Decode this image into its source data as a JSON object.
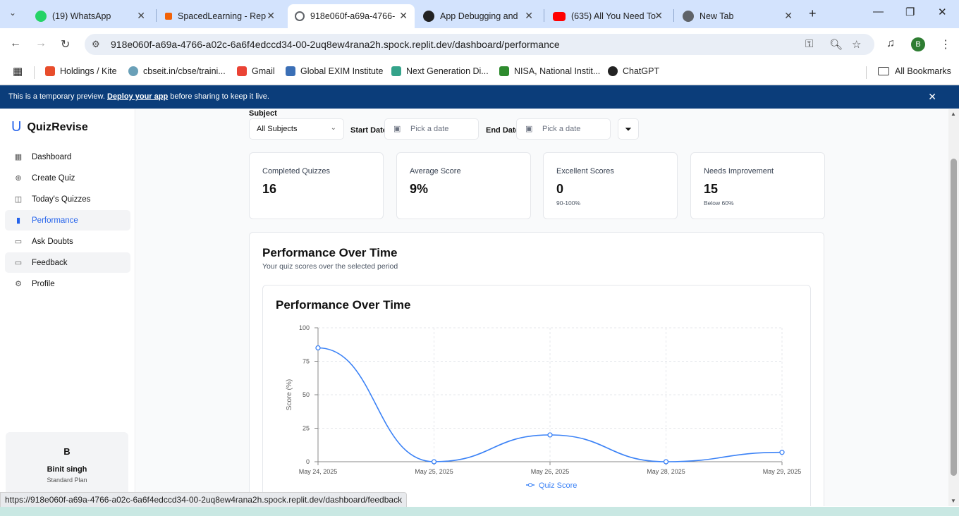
{
  "browser": {
    "tabs": [
      {
        "title": "(19) WhatsApp",
        "color": "#25d366"
      },
      {
        "title": "SpacedLearning - Rep",
        "color": "#f26207"
      },
      {
        "title": "918e060f-a69a-4766-",
        "color": "#5f6368"
      },
      {
        "title": "App Debugging and",
        "color": "#222222"
      },
      {
        "title": "(635) All You Need To",
        "color": "#ff0000"
      },
      {
        "title": "New Tab",
        "color": "#5f6368"
      }
    ],
    "url": "918e060f-a69a-4766-a02c-6a6f4edccd34-00-2uq8ew4rana2h.spock.replit.dev/dashboard/performance",
    "bookmarks": [
      {
        "label": "Holdings / Kite",
        "color": "#e84d2c"
      },
      {
        "label": "cbseit.in/cbse/traini...",
        "color": "#6aa0b8"
      },
      {
        "label": "Gmail",
        "color": "#ea4335"
      },
      {
        "label": "Global EXIM Institute",
        "color": "#3b6fb6"
      },
      {
        "label": "Next Generation Di...",
        "color": "#34a38a"
      },
      {
        "label": "NISA, National Instit...",
        "color": "#2e8b2e"
      },
      {
        "label": "ChatGPT",
        "color": "#222222"
      }
    ],
    "all_bookmarks": "All Bookmarks",
    "profile_initial": "B",
    "status_url": "https://918e060f-a69a-4766-a02c-6a6f4edccd34-00-2uq8ew4rana2h.spock.replit.dev/dashboard/feedback"
  },
  "banner": {
    "prefix": "This is a temporary preview. ",
    "link": "Deploy your app",
    "suffix": " before sharing to keep it live."
  },
  "sidebar": {
    "brand": "QuizRevise",
    "items": [
      {
        "label": "Dashboard",
        "icon": "grid-icon"
      },
      {
        "label": "Create Quiz",
        "icon": "plus-circle-icon"
      },
      {
        "label": "Today's Quizzes",
        "icon": "book-icon"
      },
      {
        "label": "Performance",
        "icon": "bar-chart-icon"
      },
      {
        "label": "Ask Doubts",
        "icon": "message-icon"
      },
      {
        "label": "Feedback",
        "icon": "message-square-icon"
      },
      {
        "label": "Profile",
        "icon": "gear-icon"
      }
    ],
    "user": {
      "initial": "B",
      "name": "Binit singh",
      "plan": "Standard Plan"
    }
  },
  "filters": {
    "subject_label": "Subject",
    "subject_value": "All Subjects",
    "start_label": "Start Date",
    "start_placeholder": "Pick a date",
    "end_label": "End Date",
    "end_placeholder": "Pick a date"
  },
  "stats": [
    {
      "label": "Completed Quizzes",
      "value": "16",
      "sub": ""
    },
    {
      "label": "Average Score",
      "value": "9%",
      "sub": ""
    },
    {
      "label": "Excellent Scores",
      "value": "0",
      "sub": "90-100%"
    },
    {
      "label": "Needs Improvement",
      "value": "15",
      "sub": "Below 60%"
    }
  ],
  "performance": {
    "title": "Performance Over Time",
    "subtitle": "Your quiz scores over the selected period"
  },
  "chart_data": {
    "type": "line",
    "title": "Performance Over Time",
    "ylabel": "Score (%)",
    "xlabel": "",
    "x": [
      "May 24, 2025",
      "May 25, 2025",
      "May 26, 2025",
      "May 28, 2025",
      "May 29, 2025"
    ],
    "series": [
      {
        "name": "Quiz Score",
        "values": [
          85,
          0,
          20,
          0,
          7
        ],
        "color": "#3b82f6"
      }
    ],
    "ylim": [
      0,
      100
    ],
    "yticks": [
      0,
      25,
      50,
      75,
      100
    ],
    "grid": true,
    "legend": "bottom"
  }
}
